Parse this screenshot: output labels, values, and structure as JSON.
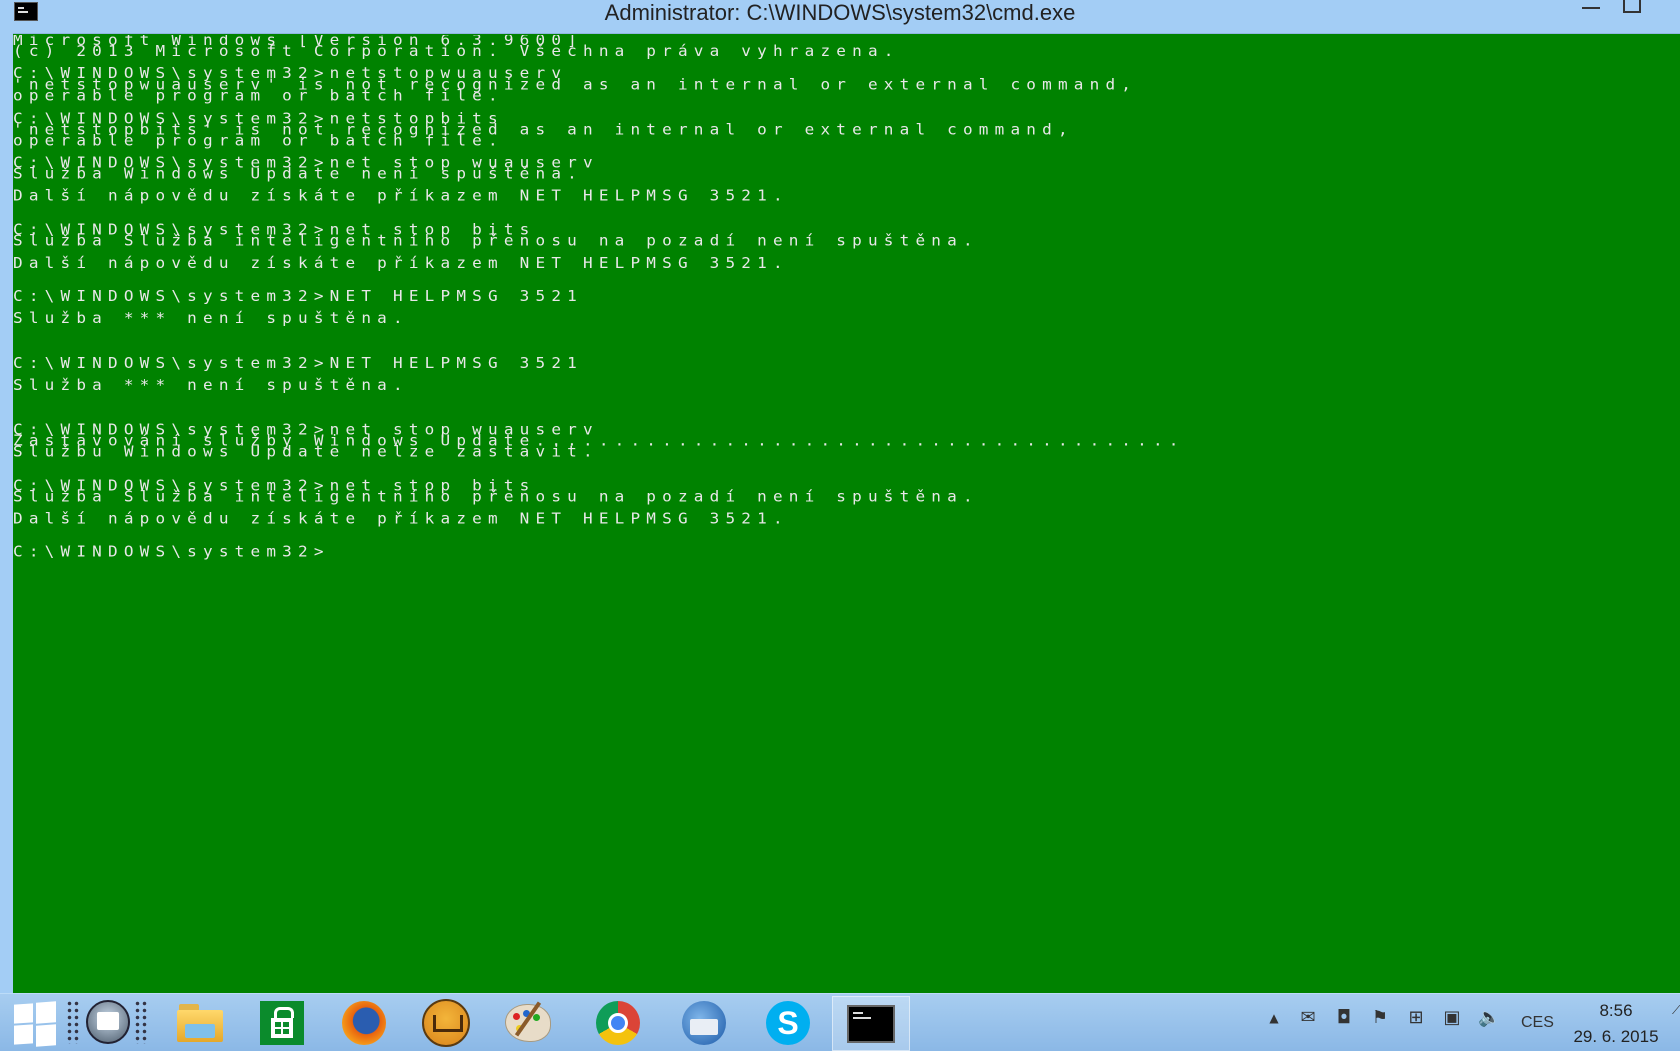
{
  "window": {
    "title": "Administrator: C:\\WINDOWS\\system32\\cmd.exe"
  },
  "console": {
    "lines": [
      "Microsoft Windows [Version 6.3.9600]",
      "(c) 2013 Microsoft Corporation. Všechna práva vyhrazena.",
      "",
      "C:\\WINDOWS\\system32>netstopwuauserv",
      "'netstopwuauserv' is not recognized as an internal or external command,",
      "operable program or batch file.",
      "",
      "C:\\WINDOWS\\system32>netstopbits",
      "'netstopbits' is not recognized as an internal or external command,",
      "operable program or batch file.",
      "",
      "C:\\WINDOWS\\system32>net stop wuauserv",
      "Služba Windows Update není spuštěna.",
      "",
      "Další nápovědu získáte příkazem NET HELPMSG 3521.",
      "",
      "",
      "C:\\WINDOWS\\system32>net stop bits",
      "Služba Služba inteligentního přenosu na pozadí není spuštěna.",
      "",
      "Další nápovědu získáte příkazem NET HELPMSG 3521.",
      "",
      "",
      "C:\\WINDOWS\\system32>NET HELPMSG 3521",
      "",
      "Služba *** není spuštěna.",
      "",
      "",
      "",
      "C:\\WINDOWS\\system32>NET HELPMSG 3521",
      "",
      "Služba *** není spuštěna.",
      "",
      "",
      "",
      "C:\\WINDOWS\\system32>net stop wuauserv",
      "Zastavování služby Windows Update.........................................",
      "Službu Windows Update nelze zastavit.",
      "",
      "",
      "C:\\WINDOWS\\system32>net stop bits",
      "Služba Služba inteligentního přenosu na pozadí není spuštěna.",
      "",
      "Další nápovědu získáte příkazem NET HELPMSG 3521.",
      "",
      "",
      "C:\\WINDOWS\\system32>"
    ]
  },
  "taskbar": {
    "apps": [
      {
        "name": "file-explorer",
        "active": false
      },
      {
        "name": "store",
        "active": false
      },
      {
        "name": "firefox",
        "active": false
      },
      {
        "name": "email-client",
        "active": false
      },
      {
        "name": "paint",
        "active": false
      },
      {
        "name": "chrome",
        "active": false
      },
      {
        "name": "thunderbird",
        "active": false
      },
      {
        "name": "skype",
        "active": false
      },
      {
        "name": "command-prompt",
        "active": true
      }
    ],
    "language": "CES",
    "time": "8:56",
    "date": "29. 6. 2015"
  },
  "colors": {
    "console_background": "#008200",
    "console_text": "#e8e8e8",
    "titlebar": "#a3cdf5"
  }
}
